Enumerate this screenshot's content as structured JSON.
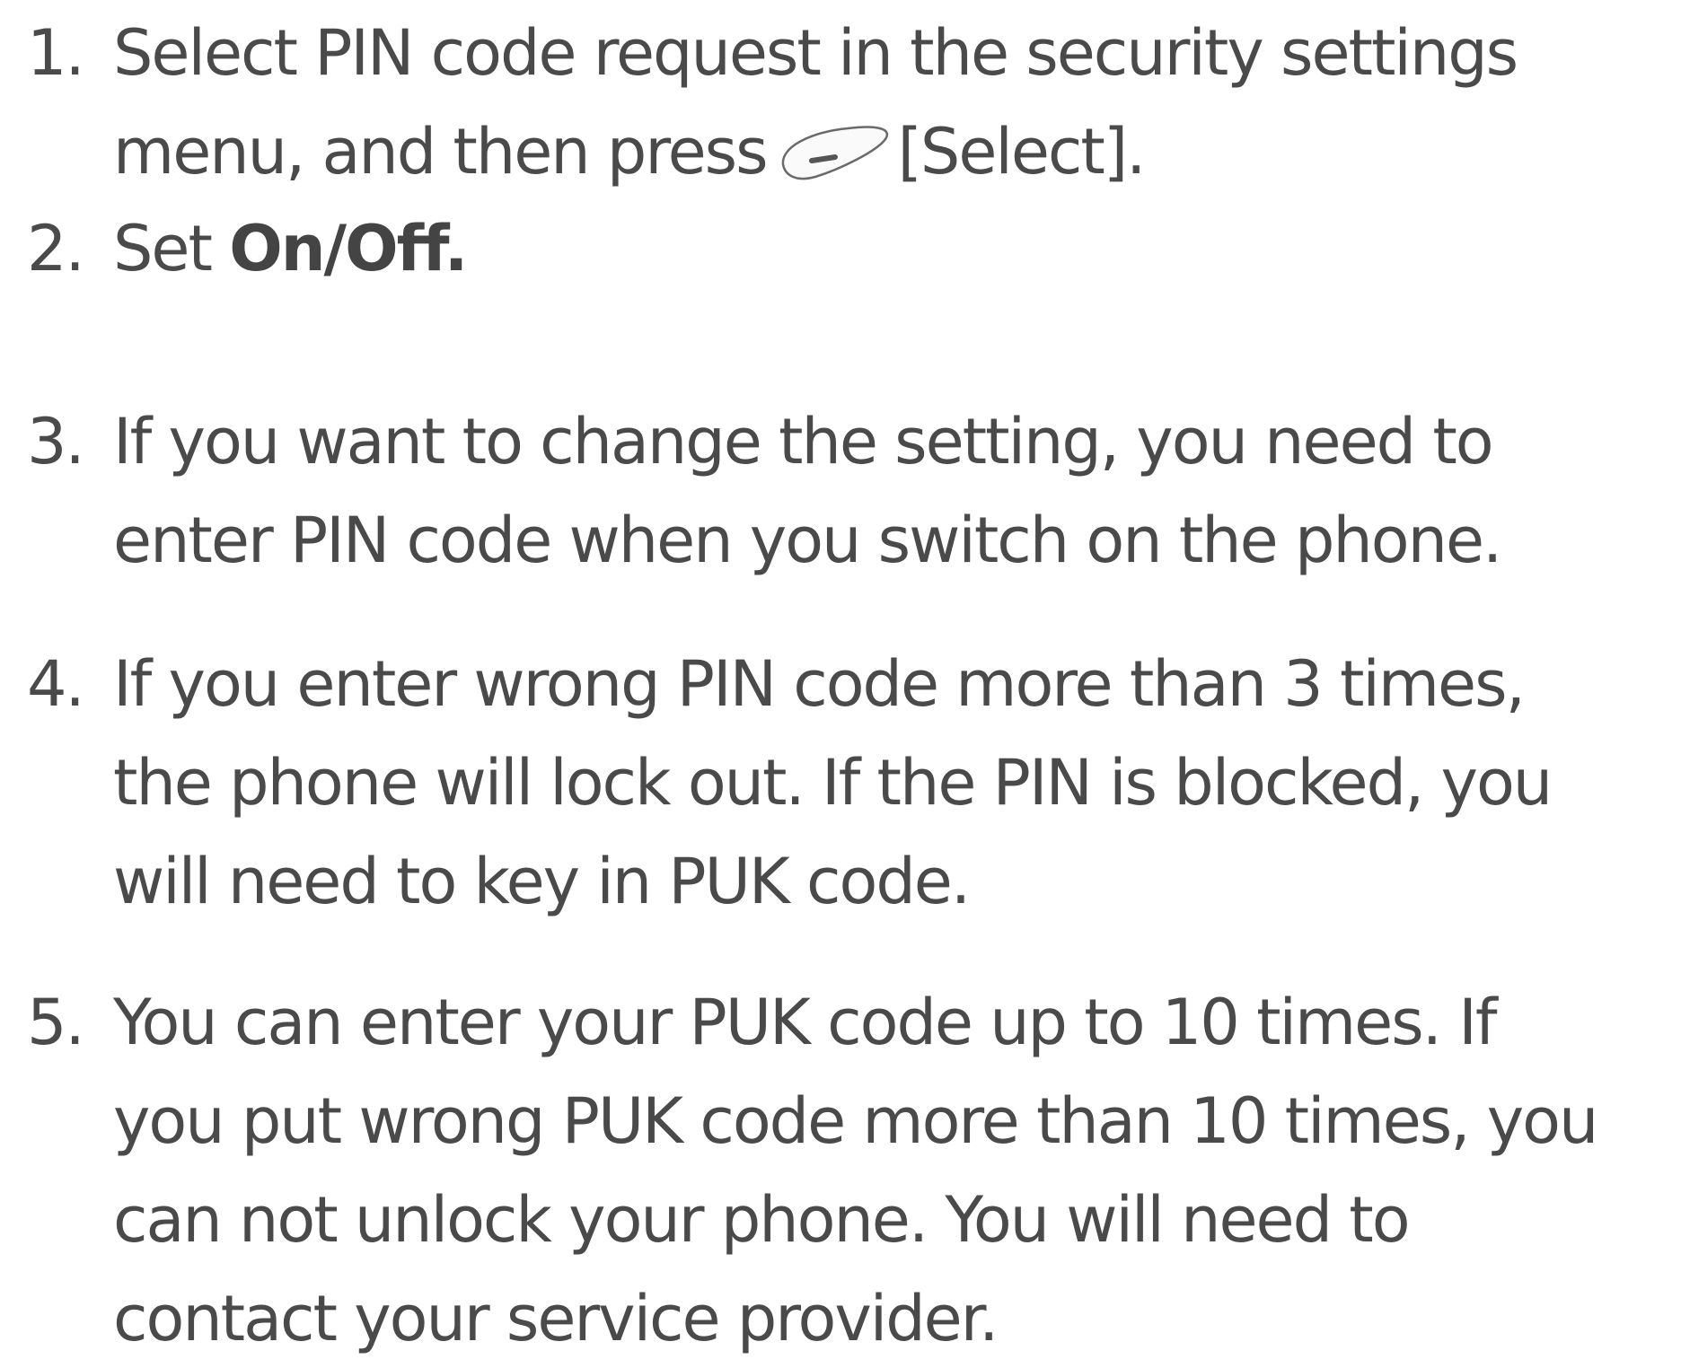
{
  "steps": [
    {
      "number": "1.",
      "lines": [
        "Select PIN code request in the security settings",
        "menu, and then press"
      ],
      "key_icon": "soft-key-icon",
      "after_key": "[Select]."
    },
    {
      "number": "2.",
      "prefix": "Set ",
      "bold": "On/Off."
    },
    {
      "number": "3.",
      "lines": [
        "If you want to change the setting, you need to",
        "enter PIN code when you switch on the phone."
      ]
    },
    {
      "number": "4.",
      "lines": [
        "If you enter wrong PIN code more than 3 times,",
        "the phone will lock out. If the PIN is blocked, you",
        "will need to key in PUK code."
      ]
    },
    {
      "number": "5.",
      "lines": [
        "You can enter your PUK code up to 10 times. If",
        "you put wrong PUK code more than 10 times, you",
        "can not unlock your phone. You will need to",
        "contact your service provider."
      ]
    }
  ]
}
